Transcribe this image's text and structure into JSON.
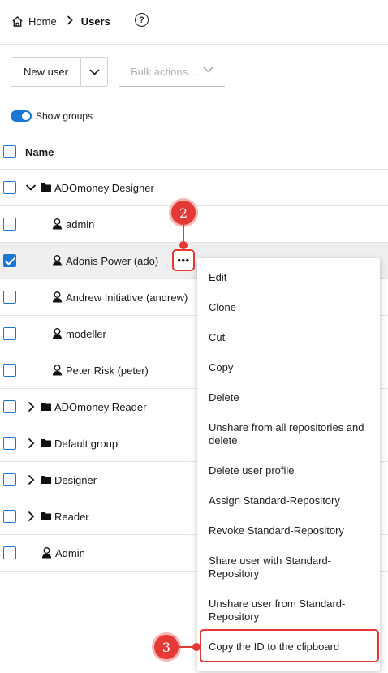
{
  "breadcrumb": {
    "home": "Home",
    "current": "Users"
  },
  "toolbar": {
    "new_user": "New user",
    "bulk_placeholder": "Bulk actions..."
  },
  "toggle": {
    "label": "Show groups",
    "on": true
  },
  "table": {
    "header": "Name",
    "rows": [
      {
        "name": "ADOmoney Designer",
        "type": "group",
        "expanded": true,
        "checked": false
      },
      {
        "name": "admin",
        "type": "user",
        "checked": false
      },
      {
        "name": "Adonis Power (ado)",
        "type": "user",
        "checked": true
      },
      {
        "name": "Andrew Initiative (andrew)",
        "type": "user",
        "checked": false
      },
      {
        "name": "modeller",
        "type": "user",
        "checked": false
      },
      {
        "name": "Peter Risk (peter)",
        "type": "user",
        "checked": false
      },
      {
        "name": "ADOmoney Reader",
        "type": "group",
        "expanded": false,
        "checked": false
      },
      {
        "name": "Default group",
        "type": "group",
        "expanded": false,
        "checked": false
      },
      {
        "name": "Designer",
        "type": "group",
        "expanded": false,
        "checked": false
      },
      {
        "name": "Reader",
        "type": "group",
        "expanded": false,
        "checked": false
      },
      {
        "name": "Admin",
        "type": "user",
        "checked": false
      }
    ]
  },
  "row_actions_icon": "more-horizontal-icon",
  "context_menu": {
    "items": [
      "Edit",
      "Clone",
      "Cut",
      "Copy",
      "Delete",
      "Unshare from all repositories and delete",
      "Delete user profile",
      "Assign Standard-Repository",
      "Revoke Standard-Repository",
      "Share user with Standard-Repository",
      "Unshare user from Standard-Repository",
      "Copy the ID to the clipboard"
    ]
  },
  "annotations": {
    "step_2": "2",
    "step_3": "3"
  },
  "colors": {
    "accent": "#1976d2",
    "annotation": "#e53935"
  }
}
